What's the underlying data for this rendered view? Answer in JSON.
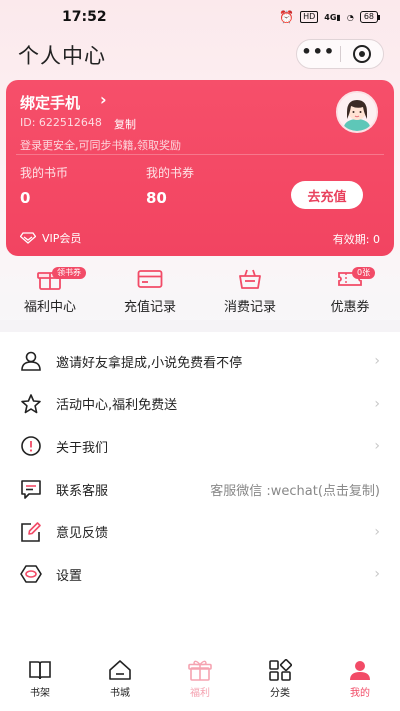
{
  "status_bar": {
    "time": "17:52",
    "hd": "HD",
    "signal": "4G",
    "battery": "68"
  },
  "header": {
    "title": "个人中心",
    "more": "•••"
  },
  "card": {
    "bind_phone": "绑定手机",
    "chevron": "›",
    "user_id": "ID: 622512648",
    "copy": "复制",
    "tip": "登录更安全,可同步书籍,领取奖励",
    "coins_label": "我的书币",
    "coins_value": "0",
    "coupons_label": "我的书券",
    "coupons_value": "80",
    "recharge": "去充值",
    "vip": "VIP会员",
    "expiry": "有效期: 0",
    "bg_color": "#f24461"
  },
  "quick": [
    {
      "label": "福利中心",
      "badge": "领书券",
      "icon": "gift-box-icon"
    },
    {
      "label": "充值记录",
      "badge": "",
      "icon": "card-icon"
    },
    {
      "label": "消费记录",
      "badge": "",
      "icon": "basket-icon"
    },
    {
      "label": "优惠券",
      "badge": "0张",
      "icon": "ticket-icon"
    }
  ],
  "menu": [
    {
      "label": "邀请好友拿提成,小说免费看不停",
      "icon": "user-icon",
      "arrow": "›"
    },
    {
      "label": "活动中心,福利免费送",
      "icon": "star-icon",
      "arrow": "›"
    },
    {
      "label": "关于我们",
      "icon": "info-icon",
      "arrow": "›"
    },
    {
      "label": "联系客服",
      "icon": "chat-icon",
      "extra": "客服微信 :wechat(点击复制)"
    },
    {
      "label": "意见反馈",
      "icon": "edit-icon",
      "arrow": "›"
    },
    {
      "label": "设置",
      "icon": "settings-icon",
      "arrow": "›"
    }
  ],
  "tabs": [
    {
      "label": "书架",
      "icon": "book-icon"
    },
    {
      "label": "书城",
      "icon": "home-icon"
    },
    {
      "label": "福利",
      "icon": "gift-icon"
    },
    {
      "label": "分类",
      "icon": "grid-icon"
    },
    {
      "label": "我的",
      "icon": "profile-icon",
      "active": true
    }
  ],
  "colors": {
    "accent": "#f24b67",
    "welfare_tab": "#f5a3b1"
  }
}
